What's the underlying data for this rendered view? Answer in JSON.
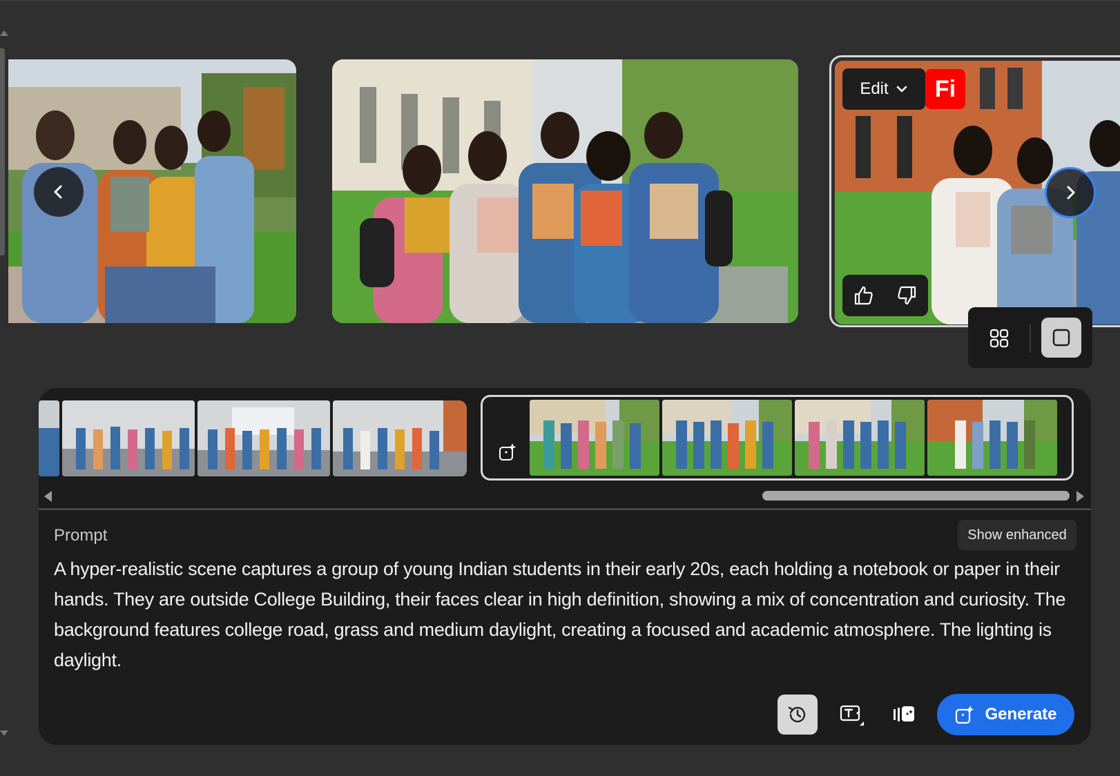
{
  "carousel": {
    "edit_label": "Edit",
    "badge_text": "Fi",
    "prev_icon": "chevron-left-icon",
    "next_icon": "chevron-right-icon",
    "feedback_icons": [
      "thumbs-up-icon",
      "thumbs-down-icon"
    ],
    "view_toggle": {
      "options": [
        "grid-view-icon",
        "single-view-icon"
      ],
      "selected": "single-view-icon"
    }
  },
  "prompt": {
    "label": "Prompt",
    "show_enhanced_label": "Show enhanced",
    "text": "A hyper-realistic scene captures a group of young Indian students in their early 20s, each holding a notebook or paper in their hands. They are outside College Building, their faces clear in high definition, showing a mix of concentration and curiosity. The background features college road, grass and medium daylight, creating a focused and academic atmosphere. The lighting is daylight."
  },
  "toolbar": {
    "tool_icons": [
      "history-icon",
      "text-effects-icon",
      "style-reference-icon"
    ],
    "generate_label": "Generate"
  },
  "colors": {
    "accent": "#1f6feb",
    "badge": "#ff0000",
    "panel": "#1c1c1c",
    "background": "#2f2f2f"
  }
}
